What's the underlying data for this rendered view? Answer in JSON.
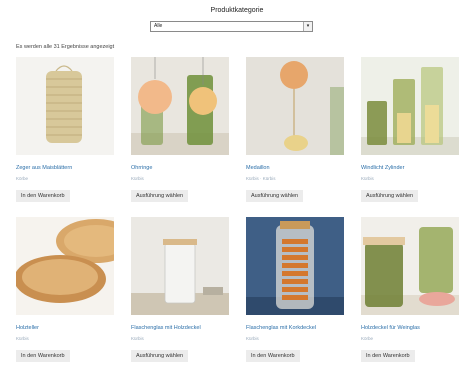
{
  "filter": {
    "title": "Produktkategorie",
    "selected": "Alle"
  },
  "result_count": "Es werden alle 31 Ergebnisse angezeigt",
  "products": [
    {
      "title": "Zeger aus Maisblättern",
      "category": "Körbe",
      "button": "In den Warenkorb"
    },
    {
      "title": "Ohrringe",
      "category": "Kürbis",
      "button": "Ausführung wählen"
    },
    {
      "title": "Medaillon",
      "category": "Kürbis · Kürbis",
      "button": "Ausführung wählen"
    },
    {
      "title": "Windlicht Zylinder",
      "category": "Kürbis",
      "button": "Ausführung wählen"
    },
    {
      "title": "Holzteller",
      "category": "Kürbis",
      "button": "In den Warenkorb"
    },
    {
      "title": "Flaschenglas mit Holzdeckel",
      "category": "Kürbis",
      "button": "Ausführung wählen"
    },
    {
      "title": "Flaschenglas mit Korkdeckel",
      "category": "Kürbis",
      "button": "In den Warenkorb"
    },
    {
      "title": "Holzdeckel für Weinglas",
      "category": "Körbe",
      "button": "In den Warenkorb"
    }
  ]
}
